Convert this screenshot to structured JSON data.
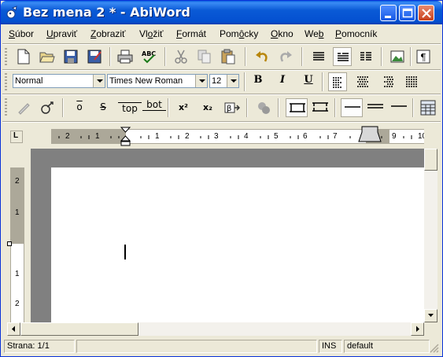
{
  "window": {
    "title": "Bez mena 2 * - AbiWord"
  },
  "menubar": {
    "items": [
      {
        "pre": "",
        "ul": "S",
        "post": "úbor"
      },
      {
        "pre": "",
        "ul": "U",
        "post": "praviť"
      },
      {
        "pre": "",
        "ul": "Z",
        "post": "obraziť"
      },
      {
        "pre": "Vl",
        "ul": "o",
        "post": "žiť"
      },
      {
        "pre": "",
        "ul": "F",
        "post": "ormát"
      },
      {
        "pre": "Pom",
        "ul": "ô",
        "post": "cky"
      },
      {
        "pre": "",
        "ul": "O",
        "post": "kno"
      },
      {
        "pre": "We",
        "ul": "b",
        "post": ""
      },
      {
        "pre": "",
        "ul": "P",
        "post": "omocník"
      }
    ]
  },
  "format_toolbar": {
    "style_value": "Normal",
    "font_value": "Times New Roman",
    "size_value": "12",
    "bold_label": "B",
    "italic_label": "I",
    "underline_label": "U"
  },
  "extra_toolbar": {
    "overline_label": "o",
    "strike_label": "S",
    "topline_label": "top",
    "bottomline_label": "bot",
    "superscript_label": "x²",
    "subscript_label": "x₂"
  },
  "hruler": {
    "labels": [
      "2",
      "1",
      "1",
      "2",
      "3",
      "4",
      "5",
      "6",
      "7",
      "9",
      "10"
    ]
  },
  "vruler": {
    "labels": [
      "2",
      "1",
      "1",
      "2"
    ]
  },
  "statusbar": {
    "page": "Strana: 1/1",
    "mode": "INS",
    "language": "default"
  },
  "colors": {
    "titlebar": "#0a5ad6",
    "face": "#ece9d8",
    "canvas": "#808080"
  },
  "icons": [
    "app-icon",
    "minimize-icon",
    "maximize-icon",
    "close-icon",
    "new-document-icon",
    "open-folder-icon",
    "save-icon",
    "save-as-icon",
    "print-icon",
    "spellcheck-icon",
    "cut-icon",
    "copy-icon",
    "paste-icon",
    "undo-icon",
    "redo-icon",
    "align-left-icon",
    "align-center-icon",
    "align-right-icon",
    "justify-icon",
    "image-icon",
    "pilcrow-icon"
  ]
}
